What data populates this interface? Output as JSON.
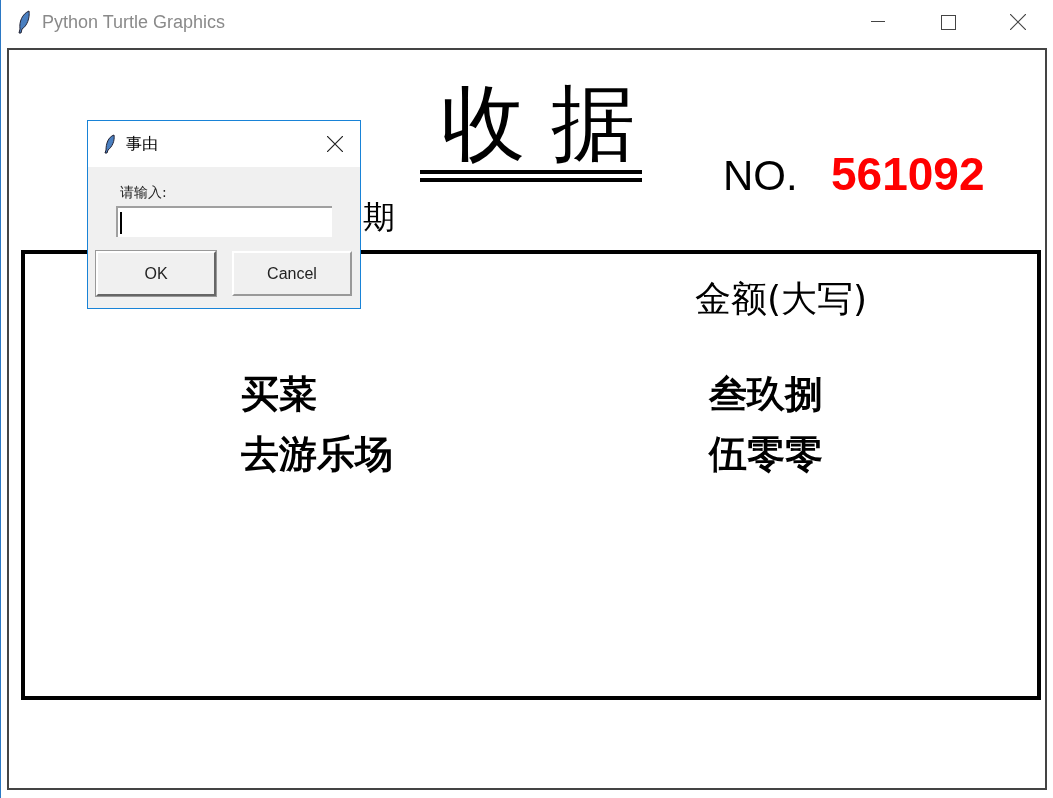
{
  "window": {
    "title": "Python Turtle Graphics"
  },
  "receipt": {
    "title": "收 据",
    "number_label": "NO.",
    "number": "561092",
    "date_label_visible": "期",
    "amount_header": "金额(大写)",
    "rows": [
      {
        "reason": "买菜",
        "amount": "叁玖捌"
      },
      {
        "reason": "去游乐场",
        "amount": "伍零零"
      }
    ]
  },
  "dialog": {
    "title": "事由",
    "prompt": "请输入:",
    "buttons": [
      "OK",
      "Cancel"
    ]
  }
}
